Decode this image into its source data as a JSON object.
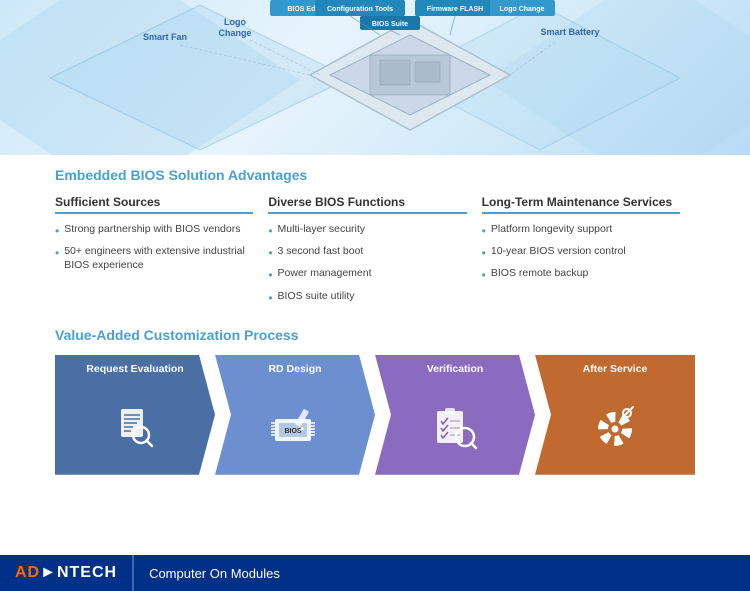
{
  "hero": {
    "labels": {
      "smart_fan": "Smart Fan",
      "logo_change": "Logo\nChange",
      "bios_editor": "BIOS Editor",
      "config_tools": "Configuration Tools",
      "bios_suite": "BIOS Suite",
      "firmware_flash": "Firmware FLASH",
      "logo_change_right": "Logo Change",
      "smart_battery": "Smart Battery"
    }
  },
  "section1": {
    "title": "Embedded BIOS Solution Advantages",
    "col1": {
      "title": "Sufficient Sources",
      "items": [
        "Strong partnership with BIOS vendors",
        "50+ engineers with extensive industrial BIOS experience"
      ]
    },
    "col2": {
      "title": "Diverse BIOS Functions",
      "items": [
        "Multi-layer security",
        "3 second fast boot",
        "Power management",
        "BIOS suite utility"
      ]
    },
    "col3": {
      "title": "Long-Term Maintenance Services",
      "items": [
        "Platform longevity support",
        "10-year BIOS version control",
        "BIOS remote backup"
      ]
    }
  },
  "section2": {
    "title": "Value-Added Customization Process",
    "steps": [
      {
        "id": "step1",
        "label": "Request Evaluation",
        "color": "#4a6fa5"
      },
      {
        "id": "step2",
        "label": "RD Design",
        "color": "#6b8fcf"
      },
      {
        "id": "step3",
        "label": "Verification",
        "color": "#7b5fb5"
      },
      {
        "id": "step4",
        "label": "After Service",
        "color": "#c06a30"
      }
    ]
  },
  "footer": {
    "brand": "AD⊢NTECH",
    "brand_ad": "AD",
    "brand_vantech": "⊢NTECH",
    "subtitle": "Computer On Modules"
  }
}
